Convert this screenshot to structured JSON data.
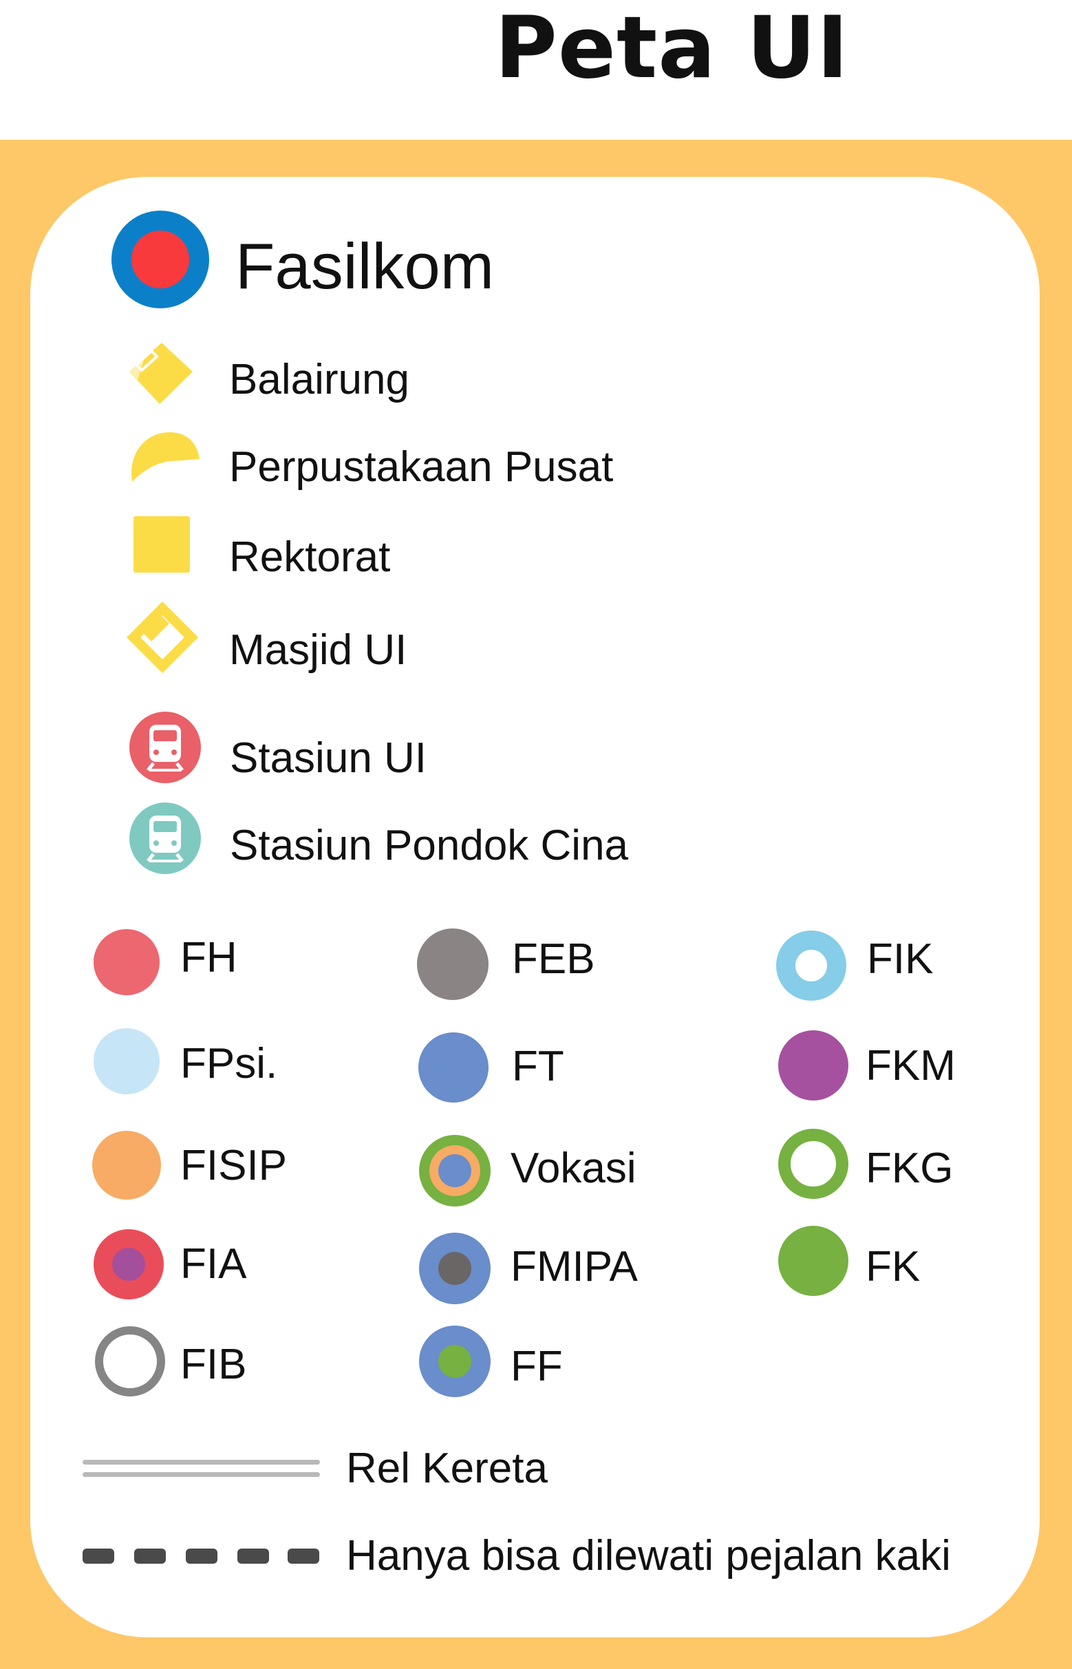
{
  "title": "Peta UI",
  "colors": {
    "frame": "#fec767",
    "fasilkom_outer": "#0b80c9",
    "fasilkom_inner": "#f83a3d",
    "landmark_yellow": "#fbdc47",
    "stasiun_ui": "#e96068",
    "stasiun_pondok_cina": "#7fc9c1"
  },
  "legend": {
    "fasilkom": {
      "label": "Fasilkom",
      "icon": "fasilkom-marker-icon"
    },
    "landmarks": [
      {
        "label": "Balairung",
        "icon": "balairung-icon"
      },
      {
        "label": "Perpustakaan Pusat",
        "icon": "perpustakaan-icon"
      },
      {
        "label": "Rektorat",
        "icon": "rektorat-icon"
      },
      {
        "label": "Masjid UI",
        "icon": "masjid-icon"
      }
    ],
    "stations": [
      {
        "label": "Stasiun UI",
        "icon": "train-icon",
        "color": "#e96068"
      },
      {
        "label": "Stasiun Pondok Cina",
        "icon": "train-icon",
        "color": "#7fc9c1"
      }
    ],
    "faculties": [
      {
        "label": "FH",
        "style": "solid",
        "color": "#ec6770"
      },
      {
        "label": "FPsi.",
        "style": "solid",
        "color": "#c6e5f6"
      },
      {
        "label": "FISIP",
        "style": "solid",
        "color": "#f7ab64"
      },
      {
        "label": "FIA",
        "style": "dot",
        "color": "#ea4d5a",
        "inner": "#a44f9c"
      },
      {
        "label": "FIB",
        "style": "ring",
        "color": "#858585",
        "inner": "#ffffff"
      },
      {
        "label": "FEB",
        "style": "solid",
        "color": "#8a8484"
      },
      {
        "label": "FT",
        "style": "solid",
        "color": "#6a8dcb"
      },
      {
        "label": "Vokasi",
        "style": "triple",
        "color": "#76b141",
        "middle": "#f7ab64",
        "inner": "#6a8dcb"
      },
      {
        "label": "FMIPA",
        "style": "dot",
        "color": "#6a8dcb",
        "inner": "#6a6666"
      },
      {
        "label": "FF",
        "style": "dot",
        "color": "#6a8dcb",
        "inner": "#76b141"
      },
      {
        "label": "FIK",
        "style": "ring",
        "color": "#86cde9",
        "inner": "#ffffff"
      },
      {
        "label": "FKM",
        "style": "solid",
        "color": "#a5519f"
      },
      {
        "label": "FKG",
        "style": "ring",
        "color": "#76b141",
        "inner": "#ffffff"
      },
      {
        "label": "FK",
        "style": "solid",
        "color": "#76b141"
      }
    ],
    "lines": [
      {
        "label": "Rel Kereta",
        "style": "double-line",
        "color": "#b9b9b9"
      },
      {
        "label": "Hanya bisa dilewati pejalan kaki",
        "style": "dashed",
        "color": "#4a4a4a"
      }
    ]
  }
}
